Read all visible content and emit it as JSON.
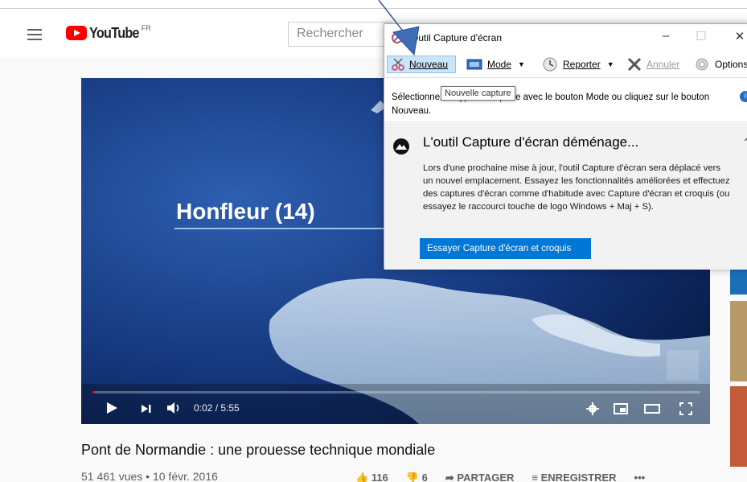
{
  "youtube": {
    "logo_text": "YouTube",
    "country_code": "FR",
    "search_placeholder": "Rechercher",
    "player": {
      "caption": "Honfleur (14)",
      "time": "0:02 / 5:55",
      "progress_fraction": 0.004
    },
    "video": {
      "title": "Pont de Normandie : une prouesse technique mondiale",
      "stats": "51 461 vues • 10 févr. 2016",
      "likes": "116",
      "dislikes": "6",
      "share_label": "PARTAGER",
      "save_label": "ENREGISTRER",
      "more_label": "•••"
    }
  },
  "snipping_tool": {
    "title": "Outil Capture d'écran",
    "toolbar": {
      "new_label": "Nouveau",
      "mode_label": "Mode",
      "delay_label": "Reporter",
      "cancel_label": "Annuler",
      "options_label": "Options"
    },
    "tooltip": "Nouvelle capture",
    "instructions": "Sélectionnez le type de capture avec le bouton Mode ou cliquez sur le bouton Nouveau.",
    "notice": {
      "title": "L'outil Capture d'écran déménage...",
      "body": "Lors d'une prochaine mise à jour, l'outil Capture d'écran sera déplacé vers un nouvel emplacement. Essayez les fonctionnalités améliorées et effectuez des captures d'écran comme d'habitude avec Capture d'écran et croquis (ou essayez le raccourci touche de logo Windows + Maj + S).",
      "button_label": "Essayer Capture d'écran et croquis"
    }
  },
  "colors": {
    "youtube_red": "#ff0000",
    "windows_blue": "#0078d7",
    "annotation_arrow": "#2f5597"
  },
  "icons": [
    "hamburger-icon",
    "youtube-play-icon",
    "snip-icon",
    "minimize-icon",
    "maximize-icon",
    "close-icon",
    "scissors-icon",
    "mode-icon",
    "clock-icon",
    "cancel-x-icon",
    "gear-icon",
    "info-icon",
    "snip-sketch-icon",
    "play-icon",
    "next-icon",
    "volume-icon",
    "settings-icon",
    "miniplayer-icon",
    "theater-icon",
    "fullscreen-icon",
    "like-icon",
    "dislike-icon",
    "share-icon",
    "save-icon"
  ]
}
